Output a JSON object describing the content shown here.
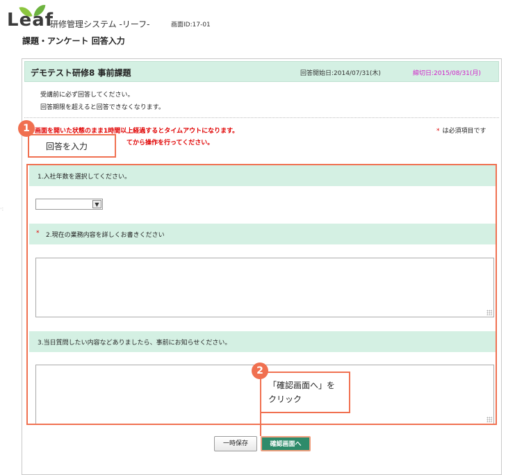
{
  "header": {
    "logo_text": "Leaf",
    "system_title": "研修管理システム -リーフ-",
    "screen_id": "画面ID:17-01",
    "page_title": "課題・アンケート 回答入力"
  },
  "card": {
    "course_title": "デモテスト研修8 事前課題",
    "answer_start": "回答開始日:2014/07/31(木)",
    "deadline": "締切日:2015/08/31(月)",
    "notices": [
      "受講前に必ず回答してください。",
      "回答期限を超えると回答できなくなります。"
    ],
    "warning_line1": "画面を開いた状態のまま1時間以上経過するとタイムアウトになります。",
    "warning_line2": "てから操作を行ってください。",
    "required_mark": "*",
    "required_note": "は必須項目です"
  },
  "questions": [
    {
      "label": "1.入社年数を選択してください。",
      "required": false,
      "type": "select",
      "value": ""
    },
    {
      "label": "2.現在の業務内容を詳しくお書きください",
      "required": true,
      "required_mark": "*",
      "type": "textarea",
      "value": ""
    },
    {
      "label": "3.当日質問したい内容などありましたら、事前にお知らせください。",
      "required": false,
      "type": "textarea",
      "value": ""
    }
  ],
  "buttons": {
    "save_draft": "一時保存",
    "confirm": "確認画面へ"
  },
  "annotations": {
    "badge1": "1",
    "callout1": "回答を入力",
    "badge2": "2",
    "callout2_line1": "「確認画面へ」を",
    "callout2_line2": "クリック"
  },
  "colors": {
    "header_bg": "#d4f0e3",
    "deadline": "#d020c8",
    "warning": "#e00000",
    "confirm_button": "#2e8b6a",
    "annotation": "#f07050"
  }
}
